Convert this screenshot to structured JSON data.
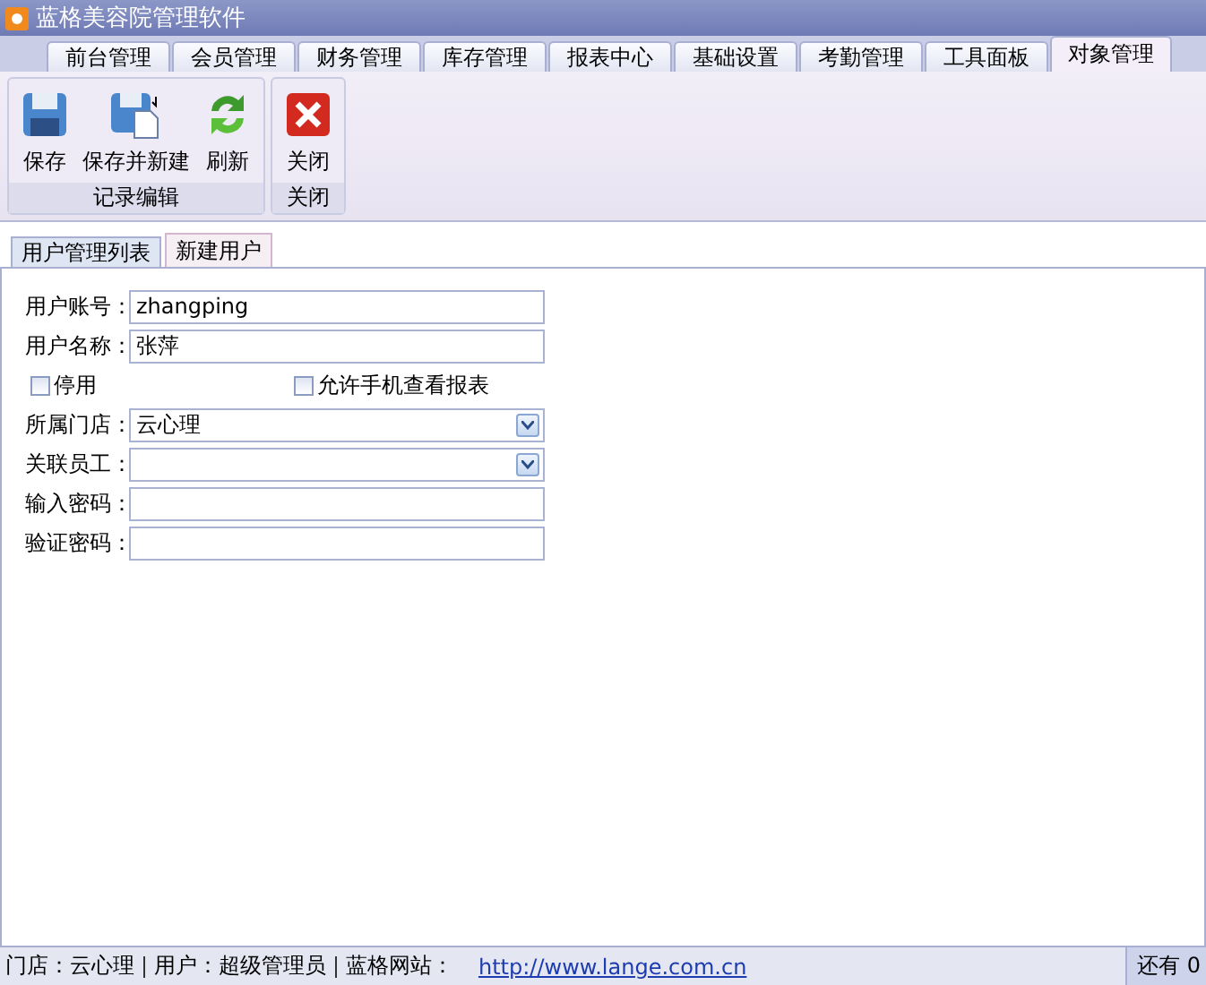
{
  "window": {
    "title": "蓝格美容院管理软件"
  },
  "tabs": [
    {
      "label": "前台管理",
      "selected": false
    },
    {
      "label": "会员管理",
      "selected": false
    },
    {
      "label": "财务管理",
      "selected": false
    },
    {
      "label": "库存管理",
      "selected": false
    },
    {
      "label": "报表中心",
      "selected": false
    },
    {
      "label": "基础设置",
      "selected": false
    },
    {
      "label": "考勤管理",
      "selected": false
    },
    {
      "label": "工具面板",
      "selected": false
    },
    {
      "label": "对象管理",
      "selected": true
    }
  ],
  "ribbon_groups": [
    {
      "title": "记录编辑",
      "buttons": [
        {
          "label": "保存",
          "kind": "save"
        },
        {
          "label": "保存并新建",
          "kind": "save-new"
        },
        {
          "label": "刷新",
          "kind": "refresh"
        }
      ]
    },
    {
      "title": "关闭",
      "buttons": [
        {
          "label": "关闭",
          "kind": "close"
        }
      ]
    }
  ],
  "sub_tabs": [
    {
      "label": "用户管理列表",
      "selected": false
    },
    {
      "label": "新建用户",
      "selected": true
    }
  ],
  "form": [
    {
      "kind": "text",
      "label": "用户账号：",
      "value": "zhangping"
    },
    {
      "kind": "text",
      "label": "用户名称：",
      "value": "张萍"
    },
    {
      "kind": "checks",
      "items": [
        {
          "label": "停用",
          "checked": false
        },
        {
          "label": "允许手机查看报表",
          "checked": false
        }
      ]
    },
    {
      "kind": "select",
      "label": "所属门店：",
      "value": "云心理"
    },
    {
      "kind": "select",
      "label": "关联员工："
    },
    {
      "kind": "text",
      "label": "输入密码："
    },
    {
      "kind": "text",
      "label": "验证密码："
    }
  ],
  "status_bar": {
    "store": "门店：云心理",
    "user": "用户：超级管理员",
    "site_label": "蓝格网站：",
    "site_link": "http://www.lange.com.cn",
    "remaining": "还有 0"
  }
}
